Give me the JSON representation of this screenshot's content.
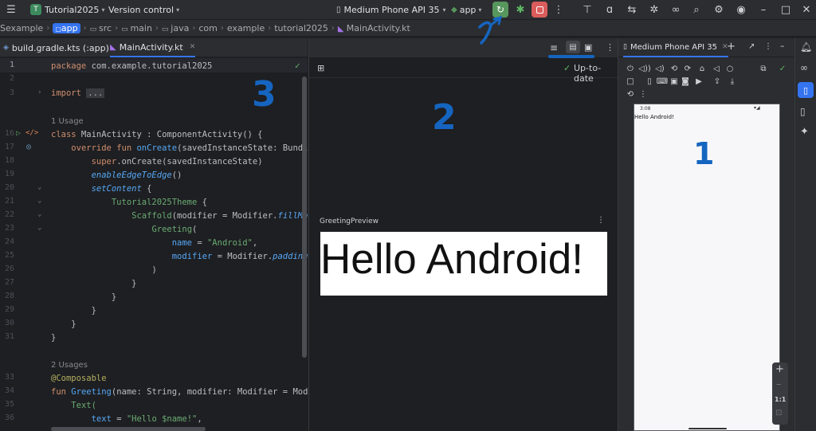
{
  "titlebar": {
    "project_badge": "T",
    "project_name": "Tutorial2025",
    "vcs": "Version control",
    "device": "Medium Phone API 35",
    "run_config": "app"
  },
  "breadcrumbs": [
    "Sexample",
    "app",
    "src",
    "main",
    "java",
    "com",
    "example",
    "tutorial2025",
    "MainActivity.kt"
  ],
  "file_tabs": {
    "tab1": "build.gradle.kts (:app)",
    "tab2": "MainActivity.kt"
  },
  "code": {
    "line_numbers": [
      "1",
      "2",
      "3",
      "",
      "16",
      "17",
      "18",
      "19",
      "20",
      "21",
      "22",
      "23",
      "24",
      "25",
      "26",
      "27",
      "28",
      "29",
      "30",
      "31",
      "",
      "33",
      "34",
      "35",
      "36"
    ],
    "l1_kw": "package",
    "l1_rest": " com.example.tutorial2025",
    "l3_kw": "import",
    "l3_fold": "...",
    "usage1": "1 Usage",
    "l16_kw": "class",
    "l16_rest": " MainActivity : ComponentActivity() {",
    "l17_kw": "override fun",
    "l17_fn": "onCreate",
    "l17_rest": "(savedInstanceState: Bundle?",
    "l18_sup": "super",
    "l18_rest": ".onCreate(savedInstanceState)",
    "l19_ext": "enableEdgeToEdge",
    "l19_rest": "()",
    "l20_ext": "setContent",
    "l20_rest": " {",
    "l21_cls": "Tutorial2025Theme",
    "l21_rest": " {",
    "l22_cls": "Scaffold",
    "l22_rest": "(modifier = Modifier.",
    "l22_ext": "fillMaxS",
    "l23_cls": "Greeting",
    "l23_rest": "(",
    "l24_par": "name",
    "l24_eq": " = ",
    "l24_str": "\"Android\"",
    "l24_end": ",",
    "l25_par": "modifier",
    "l25_eq": " = Modifier.",
    "l25_ext": "padding",
    "l25_end": "( p",
    "l26": ")",
    "l27": "}",
    "l28": "}",
    "l29": "}",
    "l30": "}",
    "l31": "}",
    "usage2": "2 Usages",
    "l33_ann": "@Composable",
    "l34_kw": "fun",
    "l34_fn": "Greeting",
    "l34_rest": "(name: String, modifier: Modifier = Modifi",
    "l35": "Text(",
    "l36_par": "text",
    "l36_eq": " = ",
    "l36_str": "\"Hello $name!\"",
    "l36_end": ","
  },
  "preview": {
    "status": "Up-to-date",
    "card_title": "GreetingPreview",
    "rendered_text": "Hello Android!"
  },
  "device_panel": {
    "tab": "Medium Phone API 35",
    "time": "3:08",
    "screen_text": "Hello Android!",
    "zoom_label": "1:1"
  },
  "annotations": {
    "a1": "1",
    "a2": "2",
    "a3": "3"
  },
  "colors": {
    "run_green": "#57965c",
    "stop_red": "#db5c5c",
    "annotation_blue": "#1565c0"
  }
}
